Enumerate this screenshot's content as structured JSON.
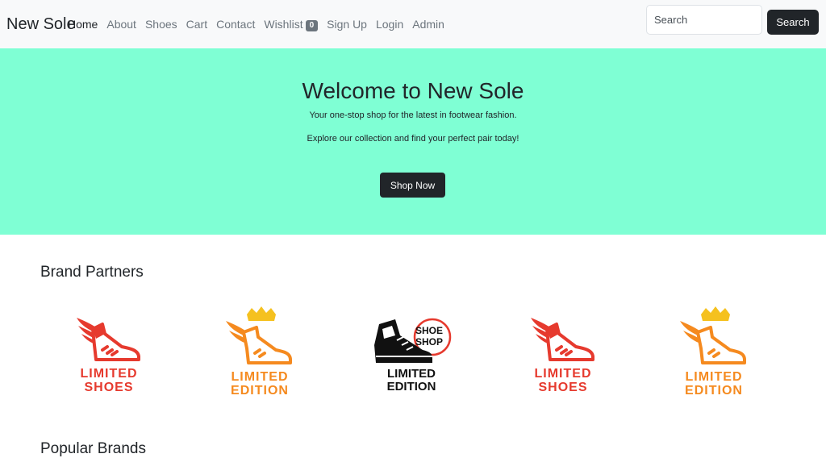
{
  "navbar": {
    "brand": "New Sole",
    "links": [
      {
        "label": "Home",
        "active": true
      },
      {
        "label": "About"
      },
      {
        "label": "Shoes"
      },
      {
        "label": "Cart"
      },
      {
        "label": "Contact"
      },
      {
        "label": "Wishlist",
        "badge": "0"
      },
      {
        "label": "Sign Up"
      },
      {
        "label": "Login"
      },
      {
        "label": "Admin"
      }
    ],
    "search": {
      "placeholder": "Search",
      "value": "",
      "button_label": "Search"
    }
  },
  "hero": {
    "title": "Welcome to New Sole",
    "subtitle": "Your one-stop shop for the latest in footwear fashion.",
    "text": "Explore our collection and find your perfect pair today!",
    "cta_label": "Shop Now",
    "background_color": "#7fffd4"
  },
  "brand_partners": {
    "title": "Brand Partners",
    "logos": [
      {
        "icon": "winged-shoe-icon",
        "line1": "LIMITED",
        "line2": "SHOES",
        "color": "#e63a2e"
      },
      {
        "icon": "winged-shoe-crown-icon",
        "line1": "LIMITED",
        "line2": "EDITION",
        "color": "#f58a1f"
      },
      {
        "icon": "sneaker-badge-icon",
        "badge_line1": "SHOE",
        "badge_line2": "SHOP",
        "line1": "LIMITED",
        "line2": "EDITION",
        "color": "#111111"
      },
      {
        "icon": "winged-shoe-icon",
        "line1": "LIMITED",
        "line2": "SHOES",
        "color": "#e63a2e"
      },
      {
        "icon": "winged-shoe-crown-icon",
        "line1": "LIMITED",
        "line2": "EDITION",
        "color": "#f58a1f"
      }
    ]
  },
  "popular_brands": {
    "title": "Popular Brands"
  }
}
